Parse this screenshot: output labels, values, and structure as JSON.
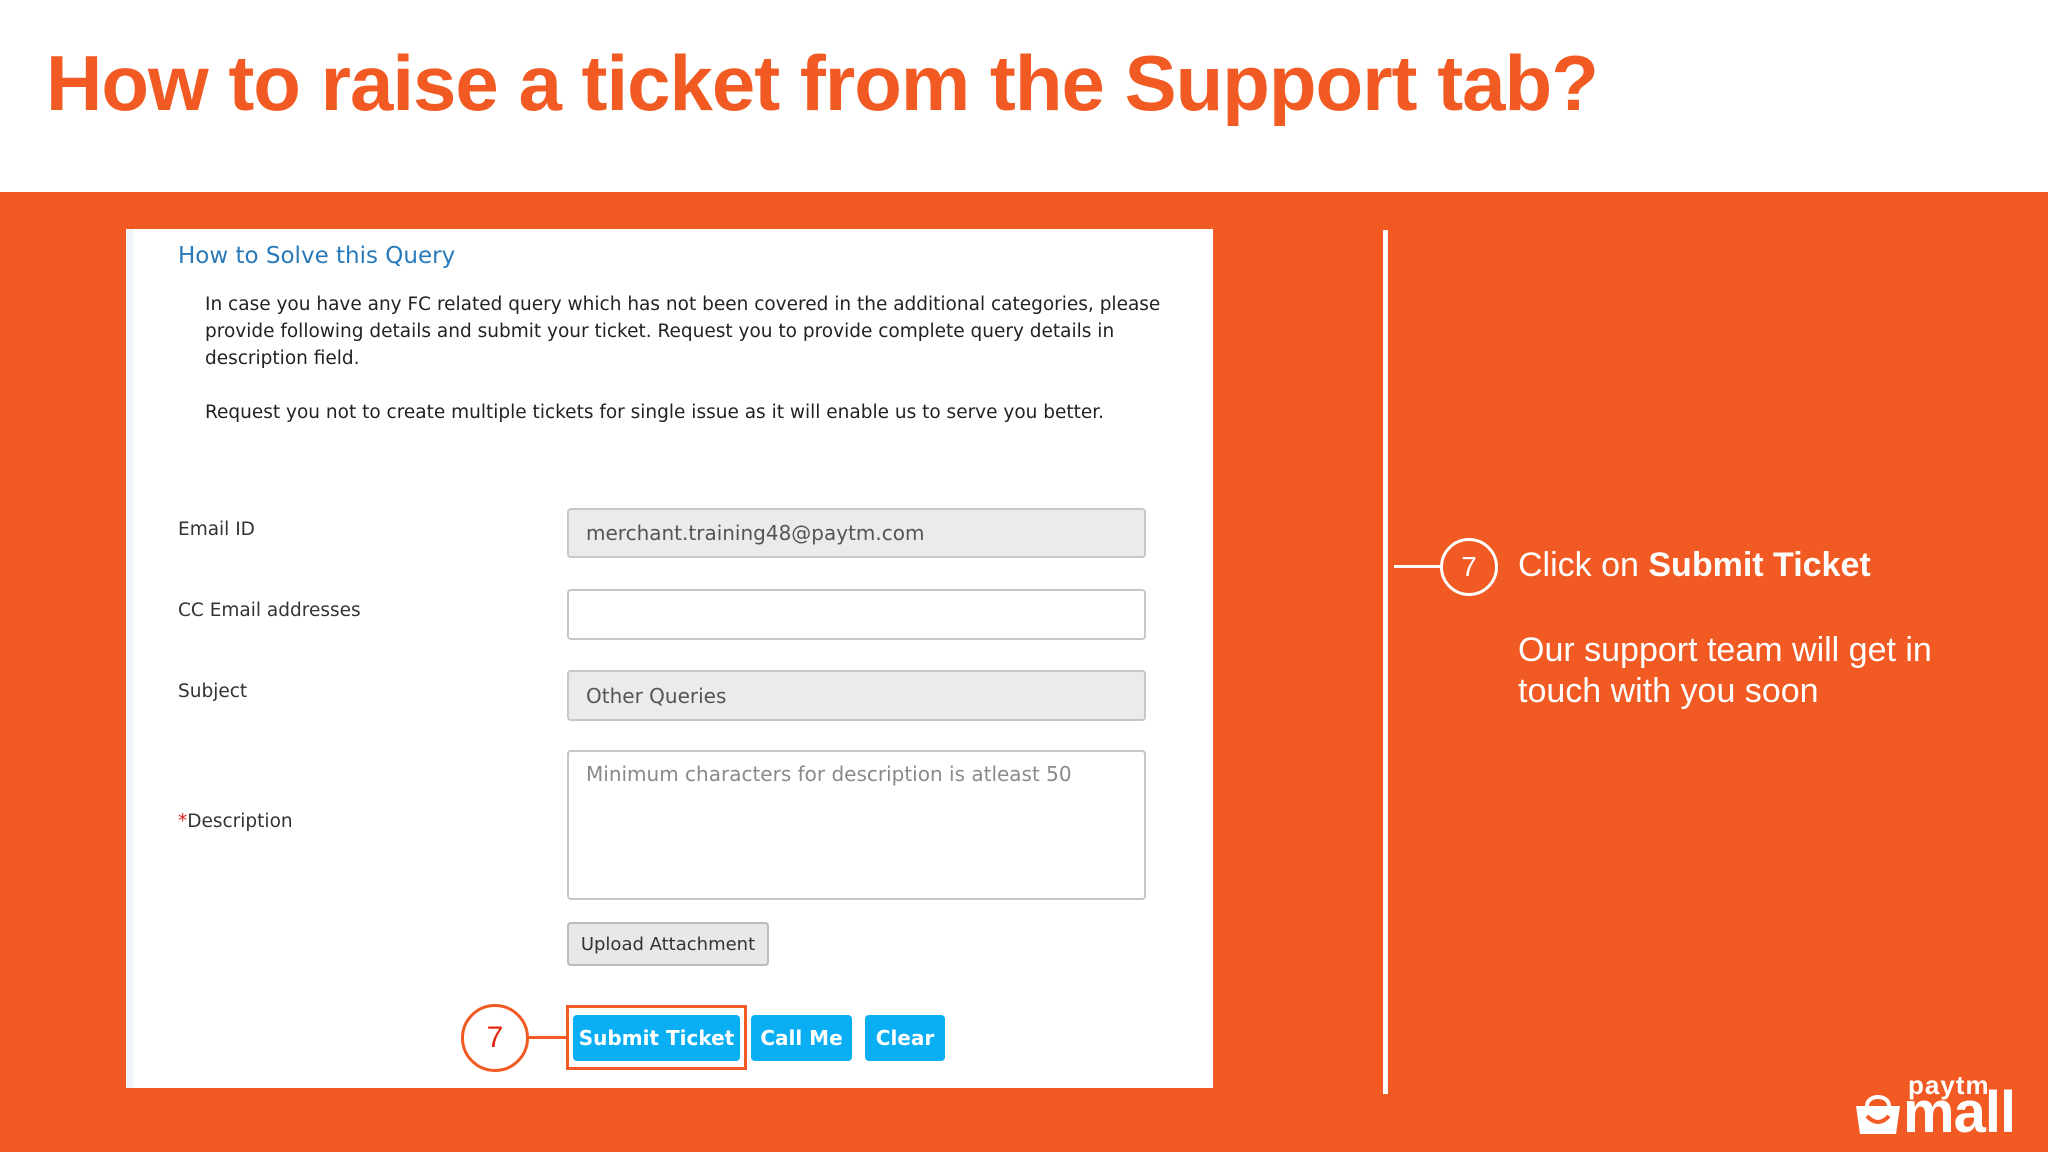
{
  "slide": {
    "title": "How to raise a ticket from the Support tab?"
  },
  "form": {
    "heading": "How to Solve this Query",
    "intro_paragraph_1": "In case you have any FC related query which has not been covered in the additional categories, please provide following details and submit your ticket. Request you to provide complete query details in description field.",
    "intro_paragraph_2": "Request you not to create multiple tickets for single issue as it will enable us to serve you better.",
    "fields": {
      "email": {
        "label": "Email ID",
        "value": "merchant.training48@paytm.com"
      },
      "cc_email": {
        "label": "CC Email addresses",
        "value": ""
      },
      "subject": {
        "label": "Subject",
        "value": "Other Queries"
      },
      "description": {
        "required_mark": "*",
        "label": "Description",
        "placeholder": "Minimum characters for description is atleast 50"
      }
    },
    "upload_label": "Upload Attachment",
    "buttons": {
      "submit": "Submit Ticket",
      "call_me": "Call Me",
      "clear": "Clear"
    },
    "step_marker": "7"
  },
  "callout": {
    "step_number": "7",
    "text_prefix": "Click on ",
    "text_bold": "Submit Ticket",
    "subtext": "Our support team will get in touch with you soon"
  },
  "logo": {
    "top": "paytm",
    "bottom": "mall"
  },
  "colors": {
    "brand_orange": "#f15a22",
    "button_blue": "#0aaef2",
    "heading_blue": "#2a7ab9"
  }
}
